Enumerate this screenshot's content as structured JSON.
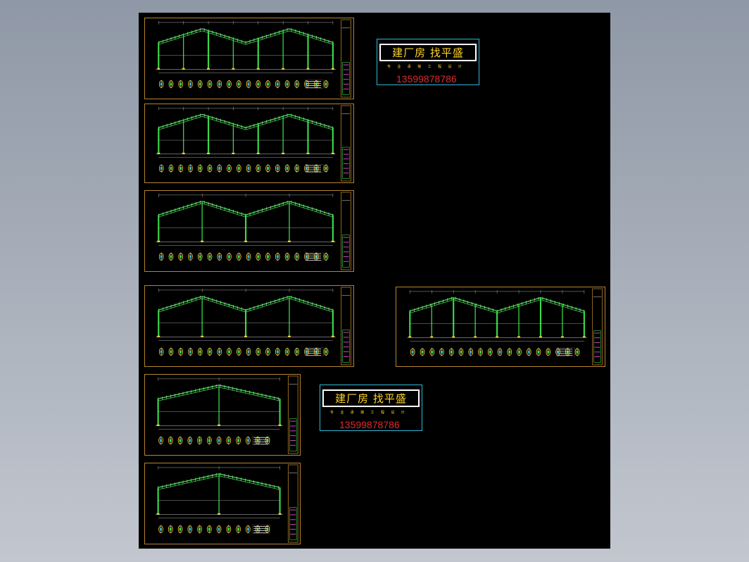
{
  "drawing": {
    "background": "#000000",
    "frame_color": "#b5852c",
    "steel_color": "#3bd84a",
    "sheet_count": 7
  },
  "stamps": [
    {
      "title": "建厂房    找平盛",
      "subtitle": "专 业 承 接   工 程 设 计",
      "phone": "13599878786"
    },
    {
      "title": "建厂房    找平盛",
      "subtitle": "专 业 承 接   工 程 设 计",
      "phone": "13599878786"
    }
  ]
}
